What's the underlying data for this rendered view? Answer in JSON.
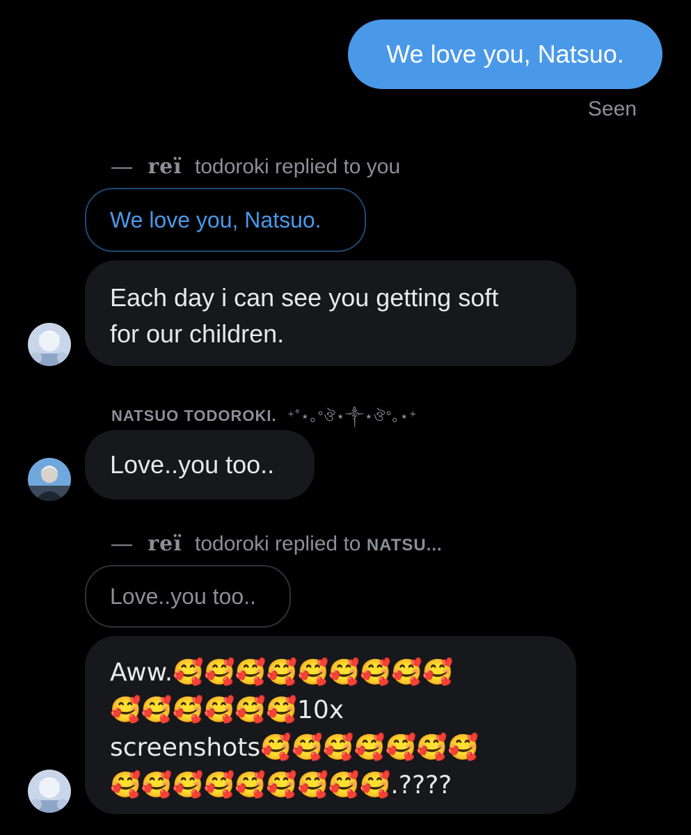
{
  "messages": {
    "sent": {
      "text": "We love you, Natsuo.",
      "status": "Seen"
    },
    "reply1": {
      "dash": "—",
      "name": "reï",
      "rest": "todoroki replied to you",
      "quote": "We love you, Natsuo.",
      "line1": "Each day i can see you getting soft",
      "line2": "for our children."
    },
    "natsuo": {
      "sender": "NATSUO TODOROKI.",
      "sender_deco": "⁺˚⋆｡°ঔ⋆༒⋆ঔ°｡⋆⁺",
      "text": "Love..you too.."
    },
    "reply2": {
      "dash": "—",
      "name": "reï",
      "rest_prefix": "todoroki replied to",
      "rest_target": "NATSU...",
      "quote": "Love..you too..",
      "line1": "Aww.🥰🥰🥰🥰🥰🥰🥰🥰🥰",
      "line2": "🥰🥰🥰🥰🥰🥰10x",
      "line3": "screenshots🥰🥰🥰🥰🥰🥰🥰",
      "line4": "🥰🥰🥰🥰🥰🥰🥰🥰🥰.????"
    }
  },
  "colors": {
    "background": "#000000",
    "sent_bubble": "#4a99e9",
    "received_bubble": "#16181c",
    "secondary_text": "#8b9096",
    "quote_blue_text": "#4a99e9",
    "quote_blue_border": "#1e4a78"
  }
}
